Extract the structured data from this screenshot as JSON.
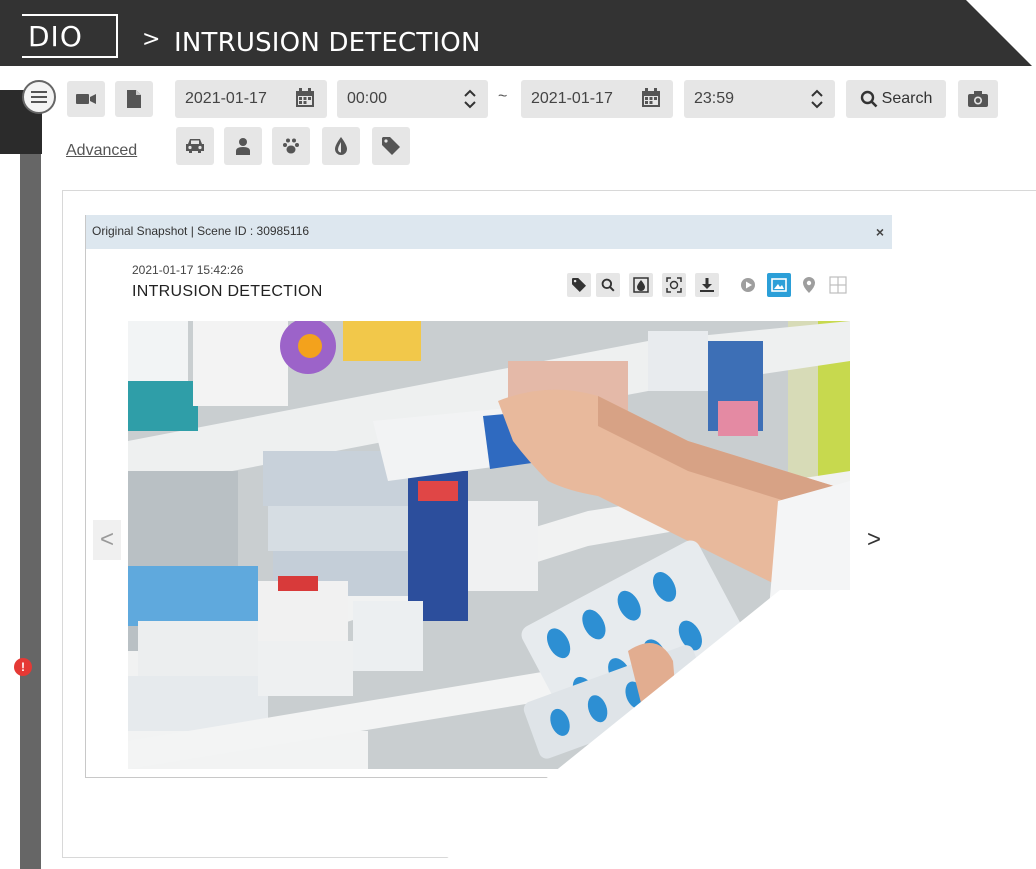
{
  "header": {
    "logo_text": "DIO",
    "separator": ">",
    "title": "INTRUSION DETECTION"
  },
  "toolbar": {
    "icons": [
      "menu-icon",
      "video-camera-icon",
      "file-icon",
      "calendar-icon",
      "up-down-icon",
      "search-icon",
      "camera-icon"
    ],
    "start_date": "2021-01-17",
    "start_time": "00:00",
    "range_sep": "~",
    "end_date": "2021-01-17",
    "end_time": "23:59",
    "search_label": "Search",
    "advanced_label": "Advanced",
    "filter_icons": [
      "car-icon",
      "person-icon",
      "paw-icon",
      "drop-icon",
      "tag-icon"
    ]
  },
  "alert": {
    "badge": "!"
  },
  "modal": {
    "title": "Original Snapshot | Scene ID : 30985116",
    "close_label": "×",
    "timestamp": "2021-01-17 15:42:26",
    "event": "INTRUSION DETECTION",
    "tool_icons": [
      "tag-icon",
      "zoom-icon",
      "contrast-icon",
      "face-scan-icon",
      "download-icon",
      "play-icon",
      "image-icon",
      "map-pin-icon",
      "grid-icon"
    ],
    "prev_label": "<",
    "next_label": ">"
  },
  "colors": {
    "header_bg": "#333333",
    "modal_header_bg": "#dde7ef",
    "active_tool": "#2b9fd8",
    "alert": "#e53935"
  }
}
